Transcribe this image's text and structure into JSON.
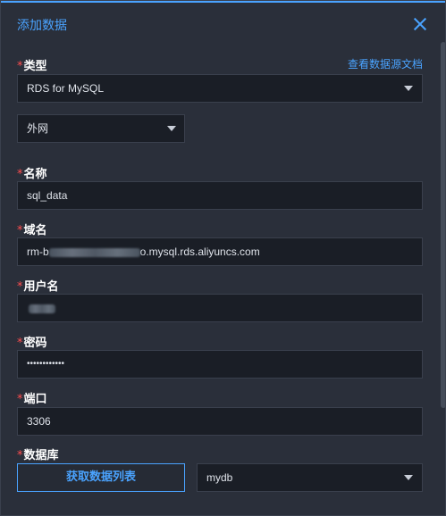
{
  "dialog": {
    "title": "添加数据",
    "close_icon": "close-icon"
  },
  "type": {
    "label": "类型",
    "required_mark": "*",
    "doc_link": "查看数据源文档",
    "value": "RDS for MySQL"
  },
  "network": {
    "value": "外网"
  },
  "name": {
    "label": "名称",
    "required_mark": "*",
    "value": "sql_data"
  },
  "domain": {
    "label": "域名",
    "required_mark": "*",
    "value_prefix": "rm-b",
    "value_suffix": "o.mysql.rds.aliyuncs.com"
  },
  "username": {
    "label": "用户名",
    "required_mark": "*"
  },
  "password": {
    "label": "密码",
    "required_mark": "*",
    "value": "••••••••••••"
  },
  "port": {
    "label": "端口",
    "required_mark": "*",
    "value": "3306"
  },
  "database": {
    "label": "数据库",
    "required_mark": "*",
    "fetch_button": "获取数据列表",
    "value": "mydb"
  },
  "colors": {
    "accent": "#4aa3ff",
    "required": "#ff4d4f",
    "panel": "#2a2f3a",
    "input_bg": "#1a1e26"
  }
}
